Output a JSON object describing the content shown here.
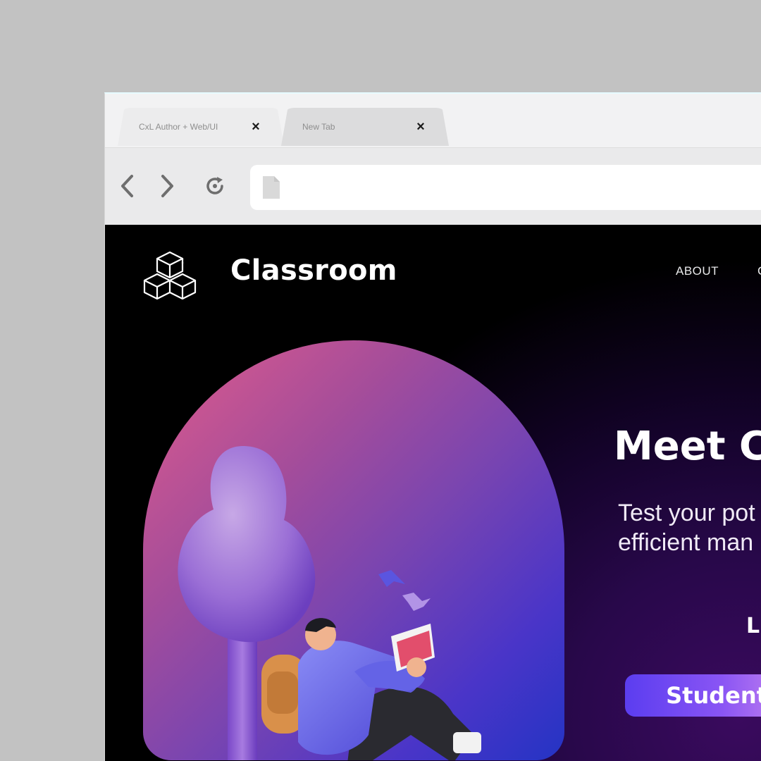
{
  "browser": {
    "tabs": [
      {
        "label": "CxL Author + Web/UI",
        "active": true
      },
      {
        "label": "New Tab",
        "active": false
      }
    ],
    "close_glyph": "×",
    "address": ""
  },
  "site": {
    "brand": "Classroom",
    "nav": [
      {
        "label": "ABOUT"
      },
      {
        "label": "C"
      }
    ]
  },
  "hero": {
    "title": "Meet C",
    "subtitle_line1": "Test your pot",
    "subtitle_line2": "efficient man",
    "cta_text": "L",
    "student_button": "Student"
  },
  "icons": {
    "back": "chevron-left-icon",
    "forward": "chevron-right-icon",
    "reload": "reload-icon",
    "page": "document-icon",
    "logo": "cubes-logo-icon"
  },
  "colors": {
    "page_bg": "#000000",
    "accent_purple": "#3a0a5e",
    "arch_pink": "#e15b8c",
    "arch_blue": "#2434c4",
    "button_start": "#5b3df0",
    "button_end": "#c07fef"
  }
}
